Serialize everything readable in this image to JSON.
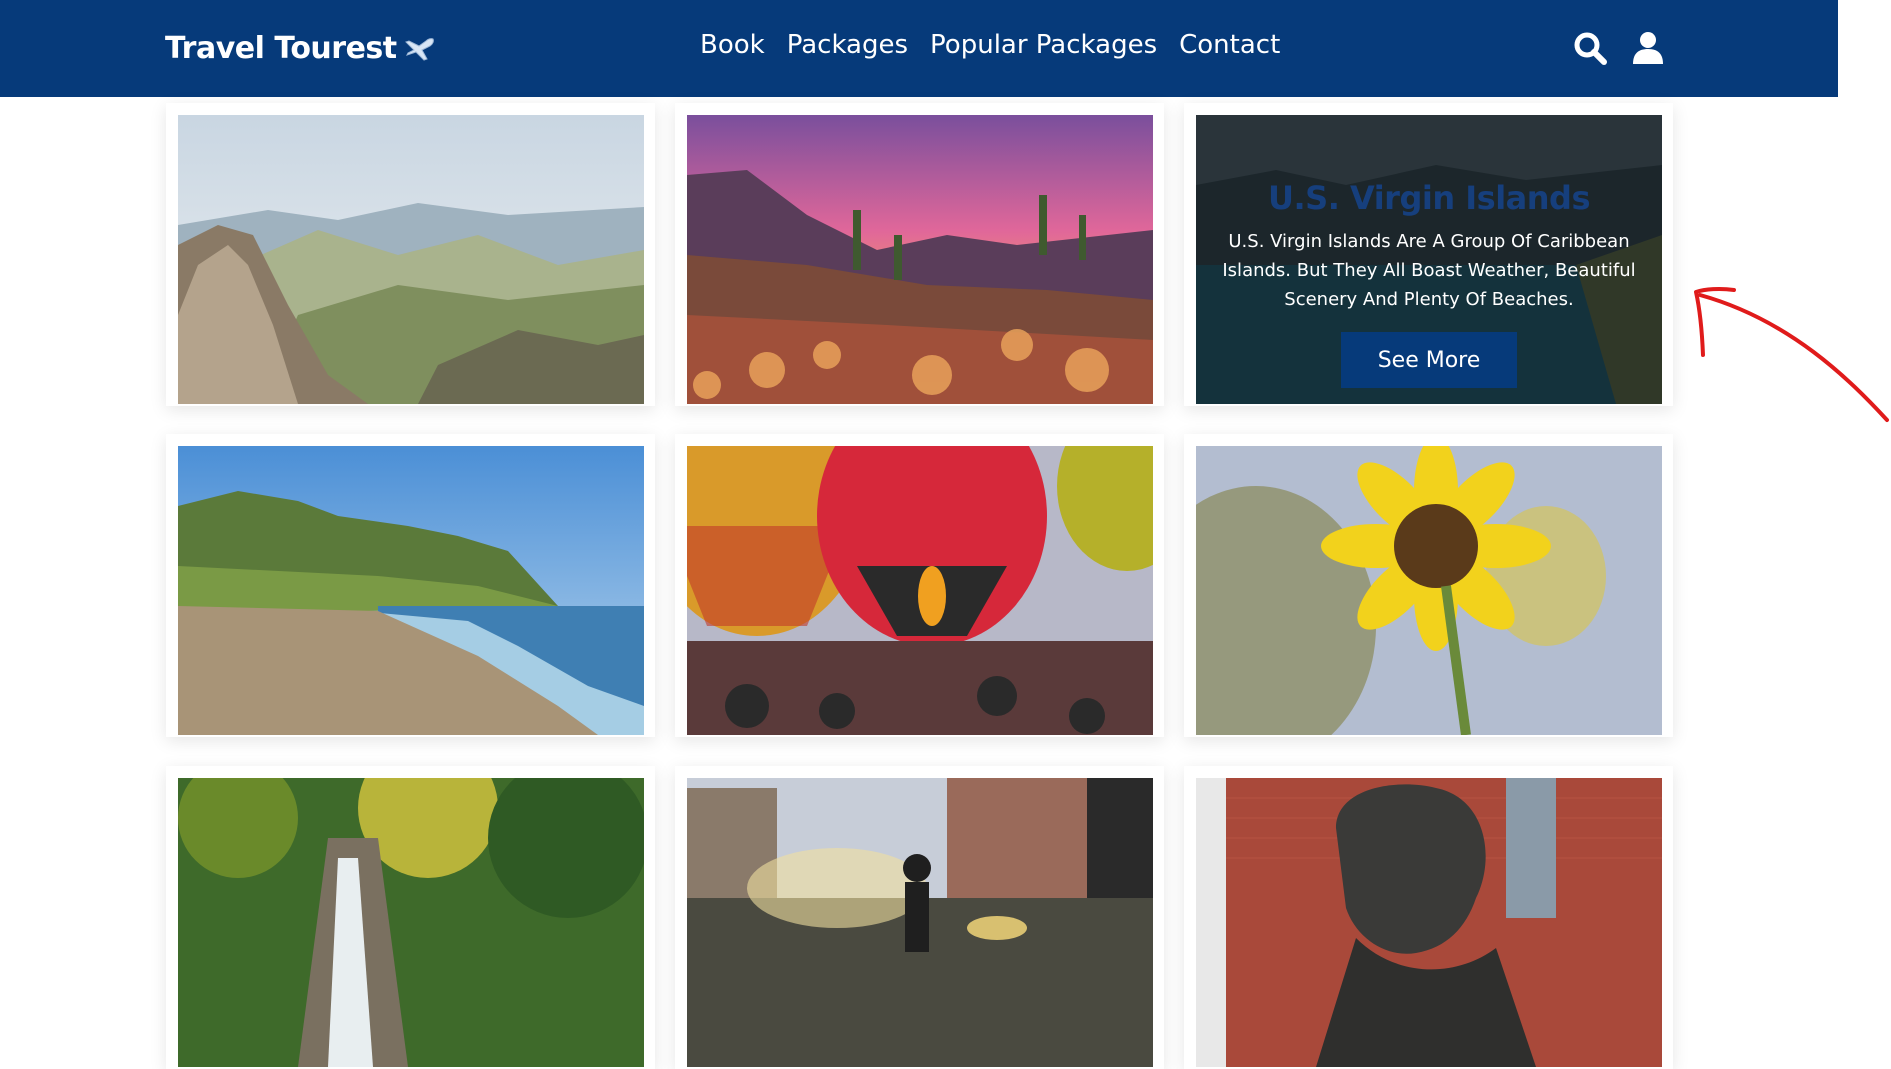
{
  "navbar": {
    "brand": "Travel Tourest",
    "links": [
      "Book",
      "Packages",
      "Popular Packages",
      "Contact"
    ],
    "icons": [
      "search-icon",
      "user-icon"
    ],
    "background": "#063a7a"
  },
  "cards": [
    {
      "scene": "mountain-valley"
    },
    {
      "scene": "desert-sunset-cactus"
    },
    {
      "scene": "virgin-islands",
      "overlay": {
        "title": "U.S. Virgin Islands",
        "text": "U.S. Virgin Islands Are A Group Of Caribbean Islands. But They All Boast Weather, Beautiful Scenery And Plenty Of Beaches.",
        "button": "See More"
      }
    },
    {
      "scene": "tropical-beach"
    },
    {
      "scene": "hot-air-balloons"
    },
    {
      "scene": "sunflower"
    },
    {
      "scene": "forest-waterfall"
    },
    {
      "scene": "outdoor-concert"
    },
    {
      "scene": "bronze-statue"
    }
  ],
  "annotation": {
    "color": "#e01b1b"
  }
}
